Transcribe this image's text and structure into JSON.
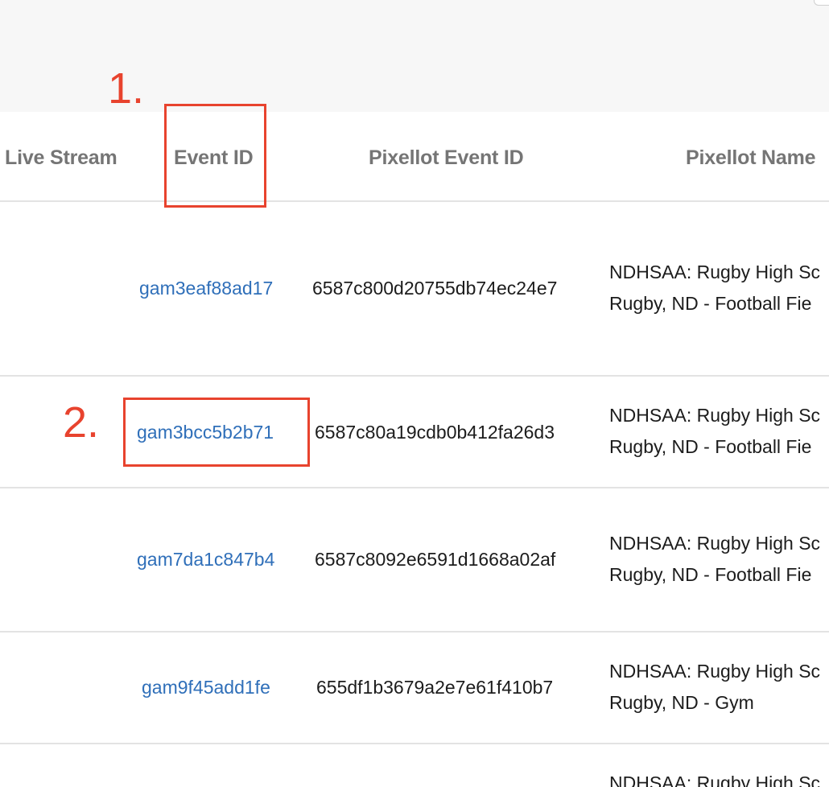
{
  "annotations": {
    "step1_label": "1.",
    "step2_label": "2.",
    "highlight_color": "#e8432e"
  },
  "table": {
    "columns": [
      "Live Stream",
      "Event ID",
      "Pixellot Event ID",
      "Pixellot Name"
    ],
    "rows": [
      {
        "event_id": "gam3eaf88ad17",
        "pixellot_event_id": "6587c800d20755db74ec24e7",
        "pixellot_name_line1": "NDHSAA: Rugby High Sc",
        "pixellot_name_line2": "Rugby, ND - Football Fie"
      },
      {
        "event_id": "gam3bcc5b2b71",
        "pixellot_event_id": "6587c80a19cdb0b412fa26d3",
        "pixellot_name_line1": "NDHSAA: Rugby High Sc",
        "pixellot_name_line2": "Rugby, ND - Football Fie"
      },
      {
        "event_id": "gam7da1c847b4",
        "pixellot_event_id": "6587c8092e6591d1668a02af",
        "pixellot_name_line1": "NDHSAA: Rugby High Sc",
        "pixellot_name_line2": "Rugby, ND - Football Fie"
      },
      {
        "event_id": "gam9f45add1fe",
        "pixellot_event_id": "655df1b3679a2e7e61f410b7",
        "pixellot_name_line1": "NDHSAA: Rugby High Sc",
        "pixellot_name_line2": "Rugby, ND - Gym"
      },
      {
        "pixellot_name_line1": "NDHSAA: Rugby High Sc"
      }
    ]
  },
  "colors": {
    "link": "#2f6fb9",
    "header_text": "#757575",
    "divider": "#e3e3e3"
  }
}
